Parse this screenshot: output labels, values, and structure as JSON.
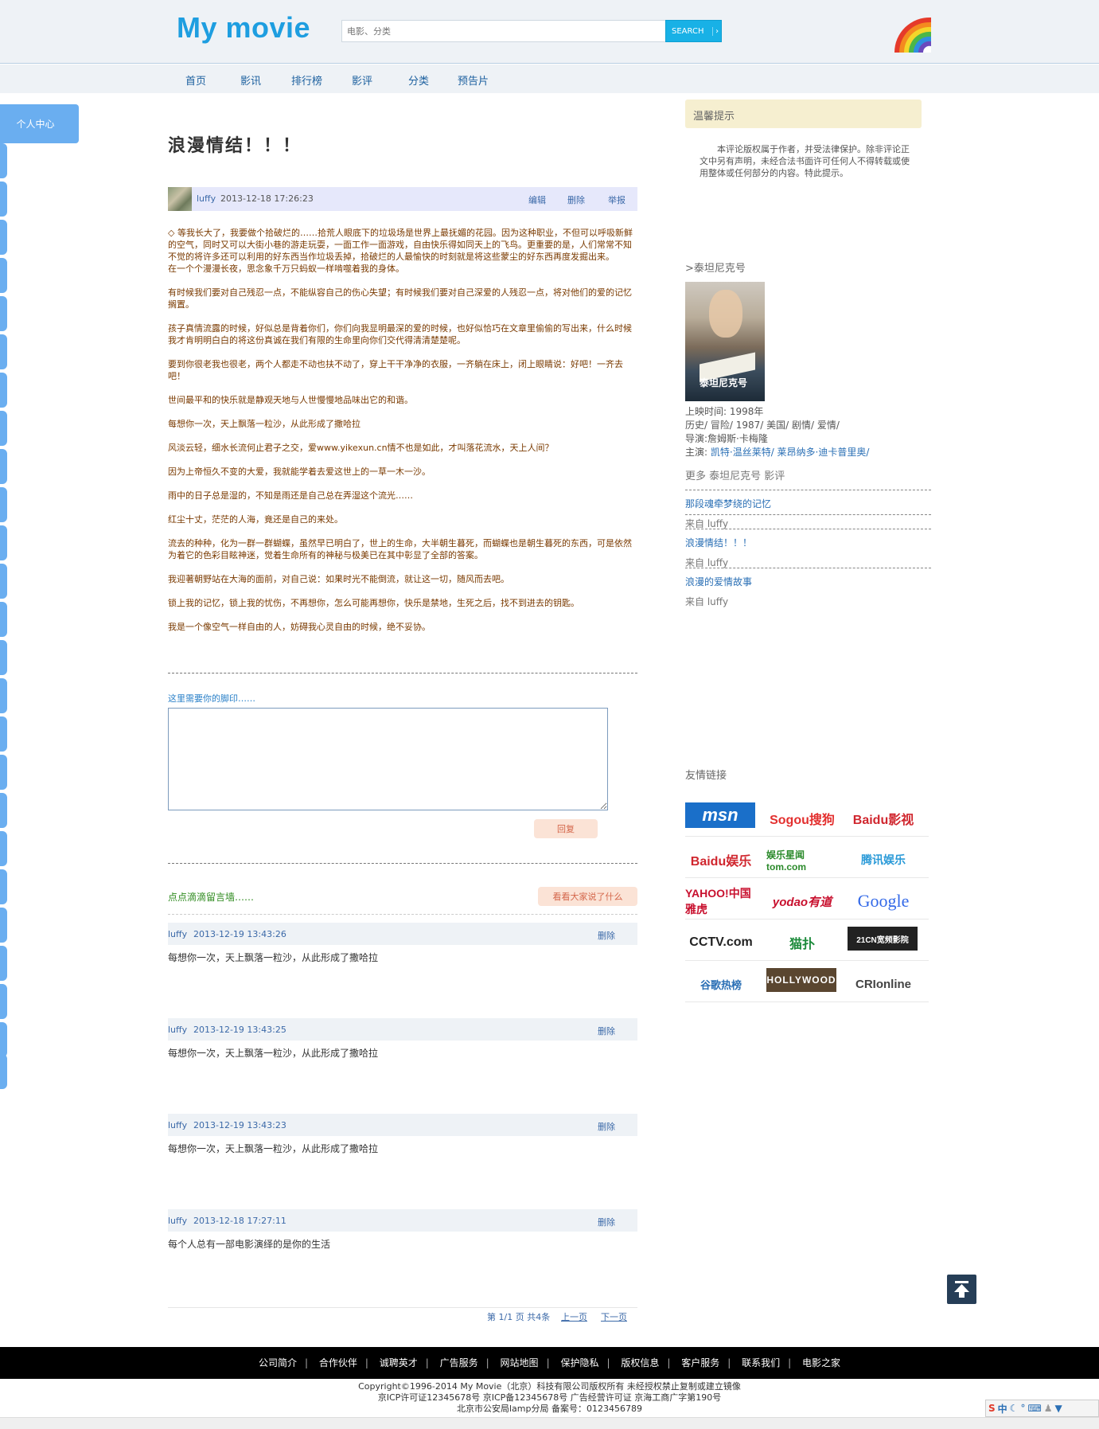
{
  "header": {
    "logo": "My movie",
    "search_placeholder": "电影、分类",
    "search_button": "SEARCH",
    "search_arrow": "›"
  },
  "nav": [
    "首页",
    "影讯",
    "排行榜",
    "影评",
    "分类",
    "预告片"
  ],
  "side": {
    "tab": "个人中心"
  },
  "article": {
    "title": "浪漫情结！！！",
    "user": "luffy",
    "time": "2013-12-18 17:26:23",
    "actions": [
      "编辑",
      "删除",
      "举报"
    ],
    "paragraphs": [
      "◇ 等我长大了，我要做个拾破烂的……拾荒人眼底下的垃圾场是世界上最抚媚的花园。因为这种职业，不但可以呼吸新鲜的空气，同时又可以大街小巷的游走玩耍，一面工作一面游戏，自由快乐得如同天上的飞鸟。更重要的是，人们常常不知不觉的将许多还可以利用的好东西当作垃圾丢掉，拾破烂的人最愉快的时刻就是将这些蒙尘的好东西再度发掘出来。",
      "在一个个漫漫长夜，思念象千万只蚂蚁一样啃噬着我的身体。",
      "",
      " 有时候我们要对自己残忍一点，不能纵容自己的伤心失望；有时候我们要对自己深爱的人残忍一点，将对他们的爱的记忆搁置。",
      "",
      " 孩子真情流露的时候，好似总是背着你们，你们向我显明最深的爱的时候，也好似恰巧在文章里偷偷的写出来，什么时候我才肯明明白白的将这份真诚在我们有限的生命里向你们交代得清清楚楚呢。",
      "",
      "要到你很老我也很老，两个人都走不动也扶不动了，穿上干干净净的衣服，一齐躺在床上，闭上眼睛说：好吧！一齐去吧！",
      "",
      " 世间最平和的快乐就是静观天地与人世慢慢地品味出它的和谐。",
      "",
      " 每想你一次，天上飘落一粒沙，从此形成了撒哈拉",
      "",
      " 风淡云轻，细水长流何止君子之交，爱www.yikexun.cn情不也是如此，才叫落花流水，天上人间？",
      "",
      "因为上帝恒久不变的大爱，我就能学着去爱这世上的一草一木一沙。",
      "",
      " 雨中的日子总是湿的，不知是雨还是自己总在弄湿这个流光……",
      "",
      " 红尘十丈，茫茫的人海，竟还是自己的来处。",
      "",
      " 流去的种种，化为一群一群蝴蝶，虽然早已明白了，世上的生命，大半朝生暮死，而蝴蝶也是朝生暮死的东西，可是依然为着它的色彩目眩神迷，觉着生命所有的神秘与极美已在其中彰显了全部的答案。",
      "",
      "我迎著朝野站在大海的面前，对自己说：如果时光不能倒流，就让这一切，随风而去吧。",
      "",
      "锁上我的记忆，锁上我的忧伤，不再想你，怎么可能再想你，快乐是禁地，生死之后，找不到进去的钥匙。",
      "",
      " 我是一个像空气一样自由的人，妨碍我心灵自由的时候，绝不妥协。"
    ]
  },
  "reply": {
    "label": "这里需要你的脚印……",
    "button": "回复"
  },
  "messages": {
    "title": "点点滴滴留言墙……",
    "button": "看看大家说了什么",
    "delete_label": "删除",
    "items": [
      {
        "user": "luffy",
        "time": "2013-12-19 13:43:26",
        "text": "每想你一次，天上飘落一粒沙，从此形成了撒哈拉"
      },
      {
        "user": "luffy",
        "time": "2013-12-19 13:43:25",
        "text": "每想你一次，天上飘落一粒沙，从此形成了撒哈拉"
      },
      {
        "user": "luffy",
        "time": "2013-12-19 13:43:23",
        "text": "每想你一次，天上飘落一粒沙，从此形成了撒哈拉"
      },
      {
        "user": "luffy",
        "time": "2013-12-18 17:27:11",
        "text": "每个人总有一部电影演绎的是你的生活"
      }
    ]
  },
  "pager": {
    "info": "第 1/1 页 共4条",
    "prev": "上一页",
    "next": "下一页"
  },
  "right": {
    "tip_title": "温馨提示",
    "tip_text": "本评论版权属于作者，并受法律保护。除非评论正文中另有声明，未经合法书面许可任何人不得转载或使用整体或任何部分的内容。特此提示。",
    "movie_link": ">泰坦尼克号",
    "poster_title": "泰坦尼克号",
    "release": "上映时间:   1998年",
    "genres": "历史/ 冒险/ 1987/ 美国/ 剧情/ 爱情/",
    "director": "导演:詹姆斯·卡梅隆",
    "cast_label": "主演:",
    "cast": "凯特·温丝莱特/ 莱昂纳多·迪卡普里奥/",
    "more_title": "更多 泰坦尼克号 影评",
    "related": [
      {
        "title": "那段魂牵梦绕的记忆",
        "from": "来自 luffy"
      },
      {
        "title": "浪漫情结！！！",
        "from": "来自 luffy"
      },
      {
        "title": "浪漫的爱情故事",
        "from": "来自 luffy"
      }
    ],
    "links_title": "友情链接",
    "logos": [
      "msn",
      "Sogou搜狗",
      "Baidu影视",
      "Baidu娱乐",
      "娱乐星闻 tom.com",
      "腾讯娱乐",
      "YAHOO!中国雅虎",
      "yodao有道",
      "Google",
      "CCTV.com",
      "猫扑",
      "21CN宽频影院",
      "谷歌热榜",
      "HOLLYWOOD",
      "CRIonline"
    ]
  },
  "footer": {
    "links": [
      "公司简介",
      "合作伙伴",
      "诚聘英才",
      "广告服务",
      "网站地图",
      "保护隐私",
      "版权信息",
      "客户服务",
      "联系我们",
      "电影之家"
    ],
    "copy1": "Copyright©1996-2014 My Movie（北京）科技有限公司版权所有 未经授权禁止复制或建立镜像",
    "copy2": "京ICP许可证12345678号 京ICP备12345678号   广告经营许可证 京海工商广字第190号",
    "copy3": "北京市公安局lamp分局 备案号：0123456789"
  },
  "ime": {
    "label": "中"
  },
  "colors": {
    "brand": "#1e9ee0",
    "search": "#18b1e6",
    "side_tab": "#6aaef0",
    "content_text": "#7a3a00"
  }
}
